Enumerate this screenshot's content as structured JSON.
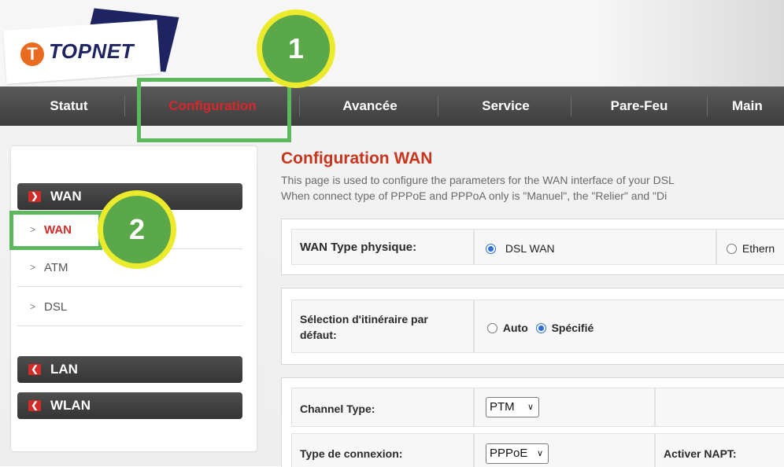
{
  "brand": {
    "logo_text": "TOPNET",
    "logo_letter": "T"
  },
  "nav": {
    "items": [
      "Statut",
      "Configuration",
      "Avancée",
      "Service",
      "Pare-Feu",
      "Main"
    ],
    "active": "Configuration"
  },
  "sidebar": {
    "wan_group": {
      "label": "WAN",
      "icon": "collapse-right-icon"
    },
    "wan_items": [
      {
        "label": "WAN",
        "active": true
      },
      {
        "label": "ATM"
      },
      {
        "label": "DSL"
      }
    ],
    "lan_group": {
      "label": "LAN",
      "icon": "expand-down-icon"
    },
    "wlan_group": {
      "label": "WLAN",
      "icon": "expand-down-icon"
    }
  },
  "main": {
    "title": "Configuration WAN",
    "desc_line1": "This page is used to configure the parameters for the WAN interface of your DSL",
    "desc_line2": "When connect type of PPPoE and PPPoA only is \"Manuel\", the \"Relier\" and \"Di",
    "wan_type": {
      "label": "WAN Type physique:",
      "option1": "DSL WAN",
      "option2": "Ethern",
      "selected": "DSL WAN"
    },
    "route": {
      "label": "Sélection d'itinéraire par défaut:",
      "option_auto": "Auto",
      "option_specified": "Spécifié",
      "selected": "Spécifié"
    },
    "channel": {
      "label": "Channel Type:",
      "value": "PTM"
    },
    "connection": {
      "label": "Type de connexion:",
      "value": "PPPoE"
    },
    "napt": {
      "label": "Activer NAPT:"
    }
  },
  "annotations": {
    "badge1": "1",
    "badge2": "2"
  },
  "colors": {
    "accent_red": "#c8341c",
    "highlight_green": "#5cb85c",
    "badge_yellow": "#ecea2c",
    "radio_blue": "#2b6fd6"
  }
}
